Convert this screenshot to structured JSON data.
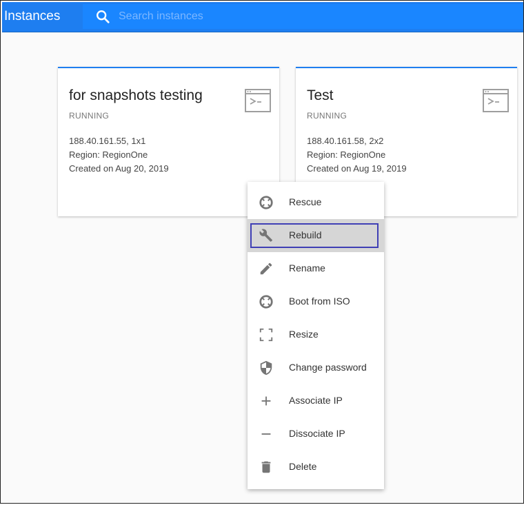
{
  "header": {
    "title": "Instances",
    "search_placeholder": "Search instances"
  },
  "instances": [
    {
      "name": "for snapshots testing",
      "status": "RUNNING",
      "address": "188.40.161.55, 1x1",
      "region": "Region: RegionOne",
      "created": "Created on Aug 20, 2019",
      "icon": "console-icon"
    },
    {
      "name": "Test",
      "status": "RUNNING",
      "address": "188.40.161.58, 2x2",
      "region": "Region: RegionOne",
      "created": "Created on Aug 19, 2019",
      "icon": "console-icon"
    }
  ],
  "menu": {
    "active": "Rebuild",
    "items": [
      {
        "label": "Rescue",
        "icon": "lifebuoy-icon"
      },
      {
        "label": "Rebuild",
        "icon": "wrench-icon"
      },
      {
        "label": "Rename",
        "icon": "pencil-icon"
      },
      {
        "label": "Boot from ISO",
        "icon": "lifebuoy-icon"
      },
      {
        "label": "Resize",
        "icon": "resize-icon"
      },
      {
        "label": "Change password",
        "icon": "shield-icon"
      },
      {
        "label": "Associate IP",
        "icon": "plus-icon"
      },
      {
        "label": "Dissociate IP",
        "icon": "minus-icon"
      },
      {
        "label": "Delete",
        "icon": "trash-icon"
      }
    ]
  },
  "colors": {
    "appbar": "#1e7ef0",
    "search_bg": "#1a86ff",
    "highlight_border": "#3f3fb5",
    "icon": "#757575"
  }
}
